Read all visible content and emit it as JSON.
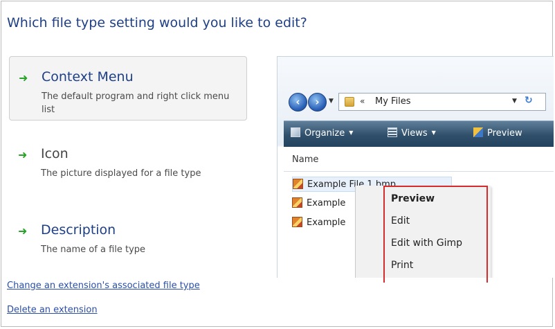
{
  "heading": "Which file type setting would you like to edit?",
  "options": [
    {
      "title": "Context Menu",
      "description": "The default program and right click menu list",
      "selected": true
    },
    {
      "title": "Icon",
      "description": "The picture displayed for a file type",
      "selected": false
    },
    {
      "title": "Description",
      "description": "The name of a file type",
      "selected": false
    }
  ],
  "links": {
    "change_extension": "Change an extension's associated file type",
    "delete_extension": "Delete an extension"
  },
  "explorer": {
    "address_chevron": "«",
    "address": "My Files",
    "toolbar": {
      "organize": "Organize",
      "views": "Views",
      "preview": "Preview"
    },
    "column_name": "Name",
    "files": [
      "Example File 1.bmp",
      "Example",
      "Example"
    ],
    "context_menu": [
      "Preview",
      "Edit",
      "Edit with Gimp",
      "Print"
    ]
  },
  "colors": {
    "heading": "#1e3f86",
    "link": "#2a4ea8",
    "arrow": "#27a327",
    "highlight_box": "#d52b2b"
  },
  "icons": {
    "option_arrow": "green-right-arrow",
    "back": "back-arrow-icon",
    "forward": "forward-arrow-icon",
    "folder": "folder-icon",
    "refresh": "refresh-icon",
    "file": "image-file-icon"
  }
}
